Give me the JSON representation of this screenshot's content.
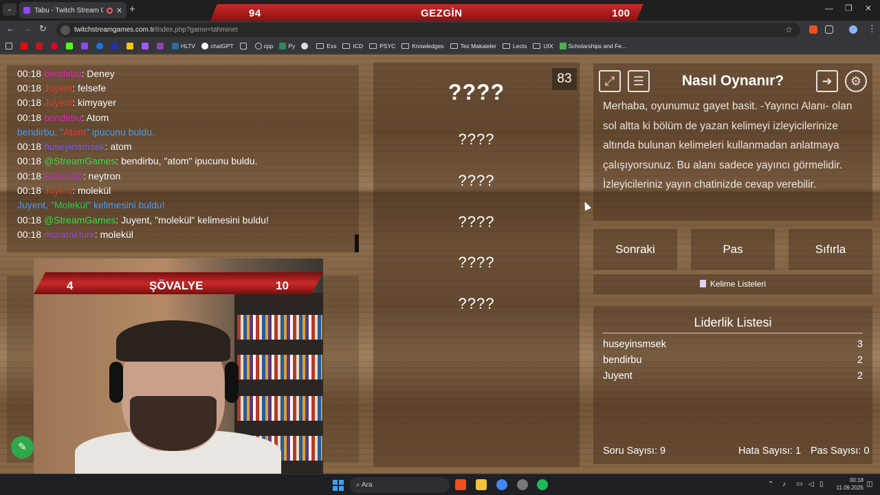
{
  "browser": {
    "tab_title": "Tabu - Twitch Stream Games",
    "url_host": "twitchstreamgames.com.tr",
    "url_path": "/index.php?game=tahminet",
    "bookmarks": [
      "HLTV",
      "chatGPT",
      "cpp",
      "Py",
      "Exs",
      "ICD",
      "PSYC",
      "Knowledges",
      "Tez Makaleler",
      "Lects",
      "UIX",
      "Scholarships and Fe..."
    ]
  },
  "overlay": {
    "top_left_score": "94",
    "top_rank": "GEZGİN",
    "top_right_score": "100",
    "cam_left_score": "4",
    "cam_rank": "ŞÖVALYE",
    "cam_right_score": "10"
  },
  "chat": [
    {
      "time": "00:18",
      "user": "bendirbu",
      "sep": ": ",
      "msg": "Deney",
      "color": "bendirbu"
    },
    {
      "time": "00:18",
      "user": "Juyent",
      "sep": ": ",
      "msg": "felsefe",
      "color": "juyent"
    },
    {
      "time": "00:18",
      "user": "Juyent",
      "sep": ": ",
      "msg": "kimyayer",
      "color": "juyent"
    },
    {
      "time": "00:18",
      "user": "bendirbu",
      "sep": ": ",
      "msg": "Atom",
      "color": "bendirbu"
    },
    {
      "time": "00:18",
      "user": "huseyinsmsek",
      "sep": ": ",
      "msg": "atom",
      "color": "huseyin"
    },
    {
      "time": "00:18",
      "user": "@StreamGames",
      "sep": ": ",
      "msg": "bendirbu, \"atom\" ipucunu buldu.",
      "color": "stream"
    },
    {
      "time": "00:18",
      "user": "Fshxio00",
      "sep": ": ",
      "msg": "neytron",
      "color": "fsh"
    },
    {
      "time": "00:18",
      "user": "Juyent",
      "sep": ": ",
      "msg": "molekül",
      "color": "juyent"
    },
    {
      "time": "00:18",
      "user": "@StreamGames",
      "sep": ": ",
      "msg": "Juyent, \"molekül\" kelimesini buldu!",
      "color": "stream"
    },
    {
      "time": "00:18",
      "user": "muratakturk",
      "sep": ": ",
      "msg": "molekül",
      "color": "murat"
    }
  ],
  "chat_system": [
    {
      "a": "bendirbu, \"",
      "b": "Atom",
      "c": "\" ipucunu buldu."
    },
    {
      "a": "Juyent, \"",
      "b": "Molekül",
      "c": "\" kelimesini buldu!"
    }
  ],
  "words": {
    "main": "????",
    "hints": [
      "????",
      "????",
      "????",
      "????",
      "????"
    ],
    "timer": "83"
  },
  "howto": {
    "title": "Nasıl Oynanır?",
    "body": "Merhaba, oyunumuz gayet basit. -Yayıncı Alanı- olan sol altta ki bölüm de yazan kelimeyi izleyicilerinize altında bulunan kelimeleri kullanmadan anlatmaya çalışıyorsunuz. Bu alanı sadece yayıncı görmelidir. İzleyicileriniz yayın chatinizde cevap verebilir."
  },
  "buttons": {
    "next": "Sonraki",
    "pass": "Pas",
    "reset": "Sıfırla",
    "word_lists": "Kelime Listeleri"
  },
  "leaderboard": {
    "title": "Liderlik Listesi",
    "rows": [
      {
        "name": "huseyinsmsek",
        "score": "3"
      },
      {
        "name": "bendirbu",
        "score": "2"
      },
      {
        "name": "Juyent",
        "score": "2"
      }
    ],
    "question_count": "Soru Sayısı: 9",
    "error_count": "Hata Sayısı: 1",
    "pass_count": "Pas Sayısı: 0"
  },
  "taskbar": {
    "search": "Ara",
    "time": "00:18",
    "date": "11.09.2025"
  }
}
